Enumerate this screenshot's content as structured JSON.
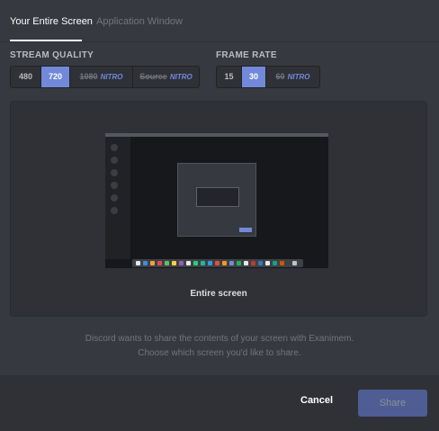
{
  "tabs": [
    {
      "label": "Your Entire Screen",
      "active": true
    },
    {
      "label": "Application Window",
      "active": false
    }
  ],
  "stream_quality": {
    "label": "STREAM QUALITY",
    "options": [
      "480",
      "720",
      "1080",
      "Source"
    ],
    "selected": "720",
    "nitro_badge": "NITRO"
  },
  "frame_rate": {
    "label": "FRAME RATE",
    "options": [
      "15",
      "30",
      "60"
    ],
    "selected": "30",
    "nitro_badge": "NITRO"
  },
  "preview": {
    "label": "Entire screen"
  },
  "description": {
    "line1": "Discord wants to share the contents of your screen with Exanimem.",
    "line2": "Choose which screen you'd like to share."
  },
  "footer": {
    "cancel_label": "Cancel",
    "share_label": "Share"
  },
  "colors": {
    "accent": "#7289da",
    "background": "#36393f",
    "panel": "#2f3136"
  }
}
